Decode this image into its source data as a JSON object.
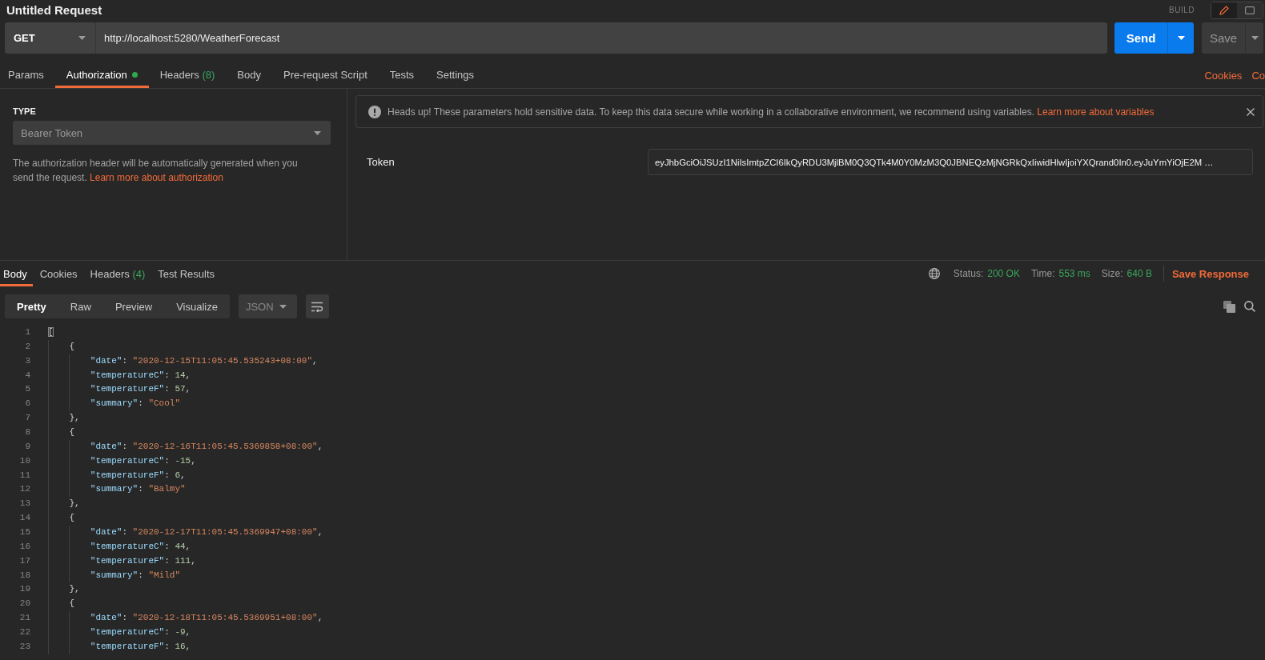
{
  "window": {
    "title": "Untitled Request",
    "mode_label": "BUILD",
    "modes": [
      {
        "kind": "edit",
        "selected": true
      },
      {
        "kind": "panel",
        "selected": false
      }
    ]
  },
  "request": {
    "method": "GET",
    "url": "http://localhost:5280/WeatherForecast",
    "send_label": "Send",
    "save_label": "Save"
  },
  "request_tabs": [
    {
      "label": "Params",
      "selected": false,
      "dot": false
    },
    {
      "label": "Authorization",
      "selected": true,
      "dot": true
    },
    {
      "label": "Headers",
      "count": "(8)",
      "selected": false,
      "dot": false
    },
    {
      "label": "Body",
      "selected": false,
      "dot": false
    },
    {
      "label": "Pre-request Script",
      "selected": false,
      "dot": false
    },
    {
      "label": "Tests",
      "selected": false,
      "dot": false
    },
    {
      "label": "Settings",
      "selected": false,
      "dot": false
    }
  ],
  "request_links": [
    "Cookies",
    "Co"
  ],
  "auth": {
    "type_label": "TYPE",
    "type_value": "Bearer Token",
    "description": "The authorization header will be automatically generated when you send the request.",
    "link": "Learn more about authorization",
    "notice": {
      "text": "Heads up! These parameters hold sensitive data. To keep this data secure while working in a collaborative environment, we recommend using variables.",
      "link": "Learn more about variables"
    },
    "fields": [
      {
        "label": "Token",
        "value": "eyJhbGciOiJSUzI1NiIsImtpZCI6IkQyRDU3MjlBM0Q3QTk4M0Y0MzM3Q0JBNEQzMjNGRkQxIiwidHlwIjoiYXQrand0In0.eyJuYmYiOjE2M …"
      }
    ]
  },
  "response": {
    "tabs": [
      {
        "label": "Body",
        "selected": true
      },
      {
        "label": "Cookies",
        "selected": false
      },
      {
        "label": "Headers",
        "count": "(4)",
        "selected": false
      },
      {
        "label": "Test Results",
        "selected": false
      }
    ],
    "meta": [
      {
        "label": "Status:",
        "value": "200 OK"
      },
      {
        "label": "Time:",
        "value": "553 ms"
      },
      {
        "label": "Size:",
        "value": "640 B"
      }
    ],
    "save_label": "Save Response",
    "views": [
      {
        "label": "Pretty",
        "selected": true
      },
      {
        "label": "Raw",
        "selected": false
      },
      {
        "label": "Preview",
        "selected": false
      },
      {
        "label": "Visualize",
        "selected": false
      }
    ],
    "format": "JSON",
    "code": [
      {
        "number": "1",
        "tokens": [
          {
            "kind": "bracket-match",
            "text": "["
          }
        ],
        "children": [
          {
            "number": "2",
            "tokens": [
              {
                "kind": "punct",
                "text": "{"
              }
            ],
            "children": [
              {
                "number": "3",
                "tokens": [
                  {
                    "kind": "key",
                    "text": "\"date\""
                  },
                  {
                    "kind": "punct",
                    "text": ": "
                  },
                  {
                    "kind": "string",
                    "text": "\"2020-12-15T11:05:45.535243+08:00\""
                  },
                  {
                    "kind": "punct",
                    "text": ","
                  }
                ]
              },
              {
                "number": "4",
                "tokens": [
                  {
                    "kind": "key",
                    "text": "\"temperatureC\""
                  },
                  {
                    "kind": "punct",
                    "text": ": "
                  },
                  {
                    "kind": "number",
                    "text": "14"
                  },
                  {
                    "kind": "punct",
                    "text": ","
                  }
                ]
              },
              {
                "number": "5",
                "tokens": [
                  {
                    "kind": "key",
                    "text": "\"temperatureF\""
                  },
                  {
                    "kind": "punct",
                    "text": ": "
                  },
                  {
                    "kind": "number",
                    "text": "57"
                  },
                  {
                    "kind": "punct",
                    "text": ","
                  }
                ]
              },
              {
                "number": "6",
                "tokens": [
                  {
                    "kind": "key",
                    "text": "\"summary\""
                  },
                  {
                    "kind": "punct",
                    "text": ": "
                  },
                  {
                    "kind": "string",
                    "text": "\"Cool\""
                  }
                ]
              }
            ]
          },
          {
            "number": "7",
            "tokens": [
              {
                "kind": "punct",
                "text": "},"
              }
            ]
          },
          {
            "number": "8",
            "tokens": [
              {
                "kind": "punct",
                "text": "{"
              }
            ],
            "children": [
              {
                "number": "9",
                "tokens": [
                  {
                    "kind": "key",
                    "text": "\"date\""
                  },
                  {
                    "kind": "punct",
                    "text": ": "
                  },
                  {
                    "kind": "string",
                    "text": "\"2020-12-16T11:05:45.5369858+08:00\""
                  },
                  {
                    "kind": "punct",
                    "text": ","
                  }
                ]
              },
              {
                "number": "10",
                "tokens": [
                  {
                    "kind": "key",
                    "text": "\"temperatureC\""
                  },
                  {
                    "kind": "punct",
                    "text": ": "
                  },
                  {
                    "kind": "number",
                    "text": "-15"
                  },
                  {
                    "kind": "punct",
                    "text": ","
                  }
                ]
              },
              {
                "number": "11",
                "tokens": [
                  {
                    "kind": "key",
                    "text": "\"temperatureF\""
                  },
                  {
                    "kind": "punct",
                    "text": ": "
                  },
                  {
                    "kind": "number",
                    "text": "6"
                  },
                  {
                    "kind": "punct",
                    "text": ","
                  }
                ]
              },
              {
                "number": "12",
                "tokens": [
                  {
                    "kind": "key",
                    "text": "\"summary\""
                  },
                  {
                    "kind": "punct",
                    "text": ": "
                  },
                  {
                    "kind": "string",
                    "text": "\"Balmy\""
                  }
                ]
              }
            ]
          },
          {
            "number": "13",
            "tokens": [
              {
                "kind": "punct",
                "text": "},"
              }
            ]
          },
          {
            "number": "14",
            "tokens": [
              {
                "kind": "punct",
                "text": "{"
              }
            ],
            "children": [
              {
                "number": "15",
                "tokens": [
                  {
                    "kind": "key",
                    "text": "\"date\""
                  },
                  {
                    "kind": "punct",
                    "text": ": "
                  },
                  {
                    "kind": "string",
                    "text": "\"2020-12-17T11:05:45.5369947+08:00\""
                  },
                  {
                    "kind": "punct",
                    "text": ","
                  }
                ]
              },
              {
                "number": "16",
                "tokens": [
                  {
                    "kind": "key",
                    "text": "\"temperatureC\""
                  },
                  {
                    "kind": "punct",
                    "text": ": "
                  },
                  {
                    "kind": "number",
                    "text": "44"
                  },
                  {
                    "kind": "punct",
                    "text": ","
                  }
                ]
              },
              {
                "number": "17",
                "tokens": [
                  {
                    "kind": "key",
                    "text": "\"temperatureF\""
                  },
                  {
                    "kind": "punct",
                    "text": ": "
                  },
                  {
                    "kind": "number",
                    "text": "111"
                  },
                  {
                    "kind": "punct",
                    "text": ","
                  }
                ]
              },
              {
                "number": "18",
                "tokens": [
                  {
                    "kind": "key",
                    "text": "\"summary\""
                  },
                  {
                    "kind": "punct",
                    "text": ": "
                  },
                  {
                    "kind": "string",
                    "text": "\"Mild\""
                  }
                ]
              }
            ]
          },
          {
            "number": "19",
            "tokens": [
              {
                "kind": "punct",
                "text": "},"
              }
            ]
          },
          {
            "number": "20",
            "tokens": [
              {
                "kind": "punct",
                "text": "{"
              }
            ],
            "children": [
              {
                "number": "21",
                "tokens": [
                  {
                    "kind": "key",
                    "text": "\"date\""
                  },
                  {
                    "kind": "punct",
                    "text": ": "
                  },
                  {
                    "kind": "string",
                    "text": "\"2020-12-18T11:05:45.5369951+08:00\""
                  },
                  {
                    "kind": "punct",
                    "text": ","
                  }
                ]
              },
              {
                "number": "22",
                "tokens": [
                  {
                    "kind": "key",
                    "text": "\"temperatureC\""
                  },
                  {
                    "kind": "punct",
                    "text": ": "
                  },
                  {
                    "kind": "number",
                    "text": "-9"
                  },
                  {
                    "kind": "punct",
                    "text": ","
                  }
                ]
              },
              {
                "number": "23",
                "tokens": [
                  {
                    "kind": "key",
                    "text": "\"temperatureF\""
                  },
                  {
                    "kind": "punct",
                    "text": ": "
                  },
                  {
                    "kind": "number",
                    "text": "16"
                  },
                  {
                    "kind": "punct",
                    "text": ","
                  }
                ]
              }
            ]
          }
        ]
      }
    ]
  }
}
